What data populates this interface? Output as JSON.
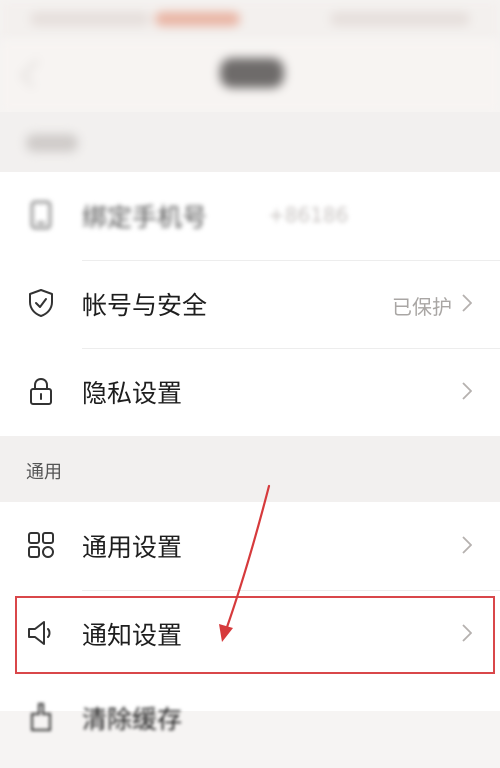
{
  "account": {
    "items": [
      {
        "icon": "phone-icon",
        "label": "绑定手机号",
        "value": "+86186"
      },
      {
        "icon": "shield-check-icon",
        "label": "帐号与安全",
        "value": "已保护"
      },
      {
        "icon": "lock-icon",
        "label": "隐私设置",
        "value": ""
      }
    ]
  },
  "general": {
    "header": "通用",
    "items": [
      {
        "icon": "grid-icon",
        "label": "通用设置"
      },
      {
        "icon": "speaker-icon",
        "label": "通知设置"
      },
      {
        "icon": "brush-icon",
        "label": "清除缓存"
      }
    ]
  },
  "colors": {
    "highlight": "#d9474a",
    "accent": "#e4582c"
  }
}
